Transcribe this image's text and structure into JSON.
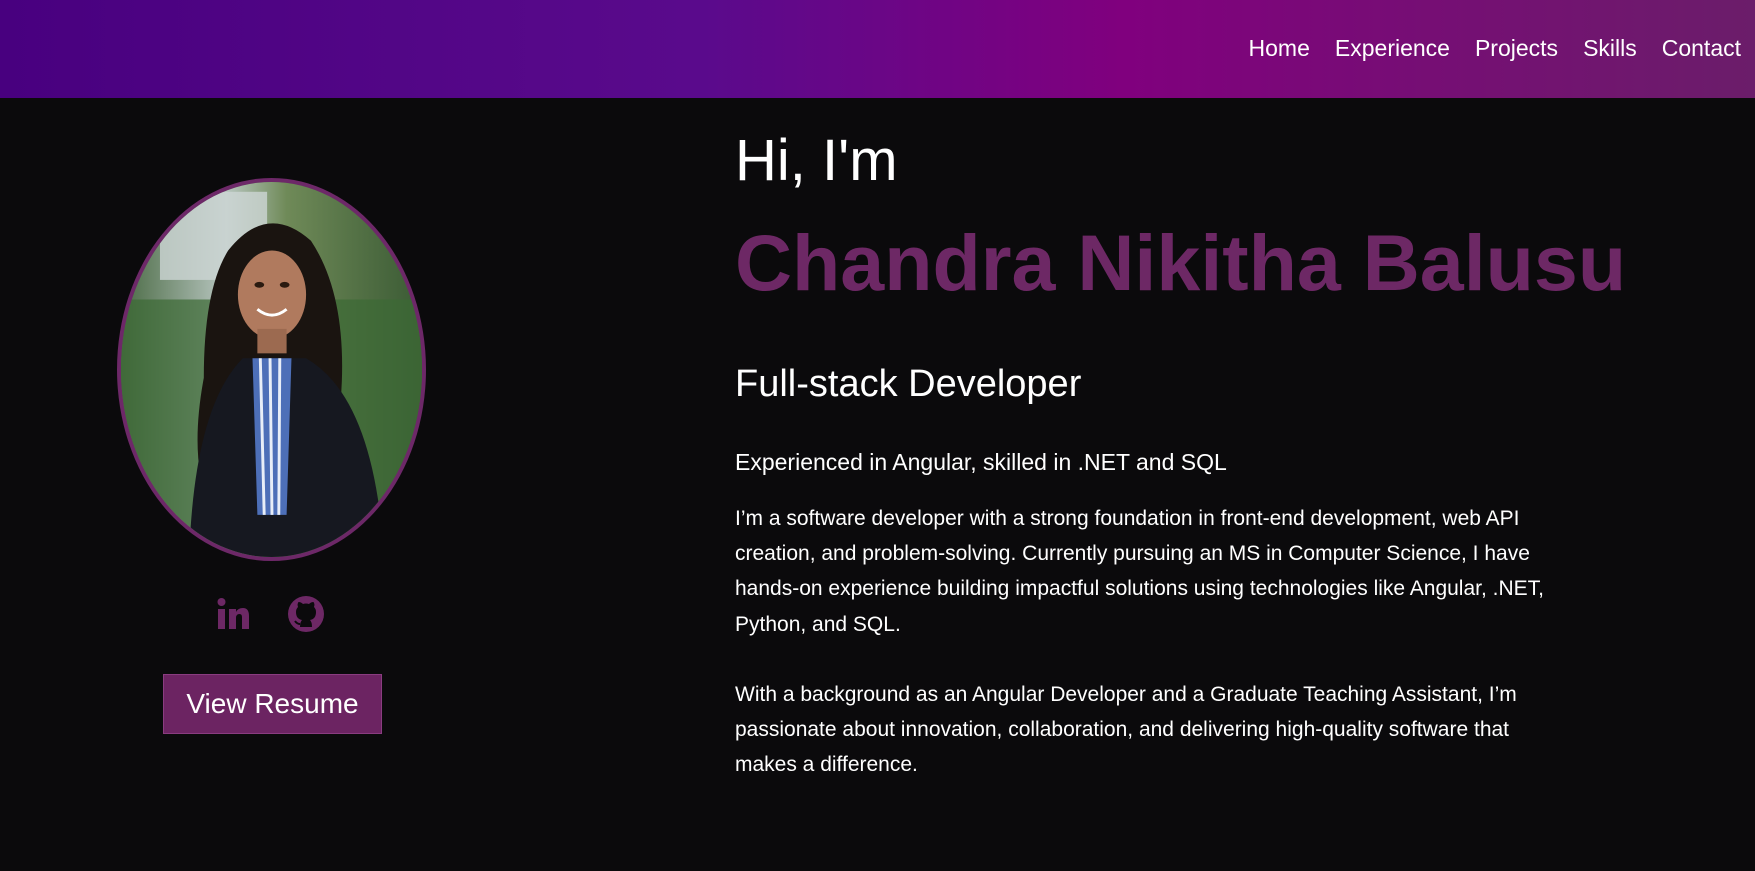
{
  "nav": {
    "items": [
      "Home",
      "Experience",
      "Projects",
      "Skills",
      "Contact"
    ]
  },
  "profile": {
    "photo_alt": "profile-photo"
  },
  "socials": {
    "linkedin_icon": "linkedin-icon",
    "github_icon": "github-icon"
  },
  "resume": {
    "label": "View Resume"
  },
  "hero": {
    "greeting": "Hi, I'm",
    "name": "Chandra Nikitha Balusu",
    "role": "Full-stack Developer",
    "tagline": "Experienced in Angular, skilled in .NET and SQL",
    "bio": [
      "I’m a software developer with a strong foundation in front-end development, web API creation, and problem-solving. Currently pursuing an MS in Computer Science, I have hands-on experience building impactful solutions using technologies like Angular, .NET, Python, and SQL.",
      "With a background as an Angular Developer and a Graduate Teaching Assistant, I’m passionate about innovation, collaboration, and delivering high-quality software that makes a difference."
    ]
  },
  "colors": {
    "accent": "#6d2865",
    "background": "#0b0a0c",
    "header_start": "#48007f",
    "header_mid": "#80007e",
    "header_end": "#6b1d6a"
  }
}
